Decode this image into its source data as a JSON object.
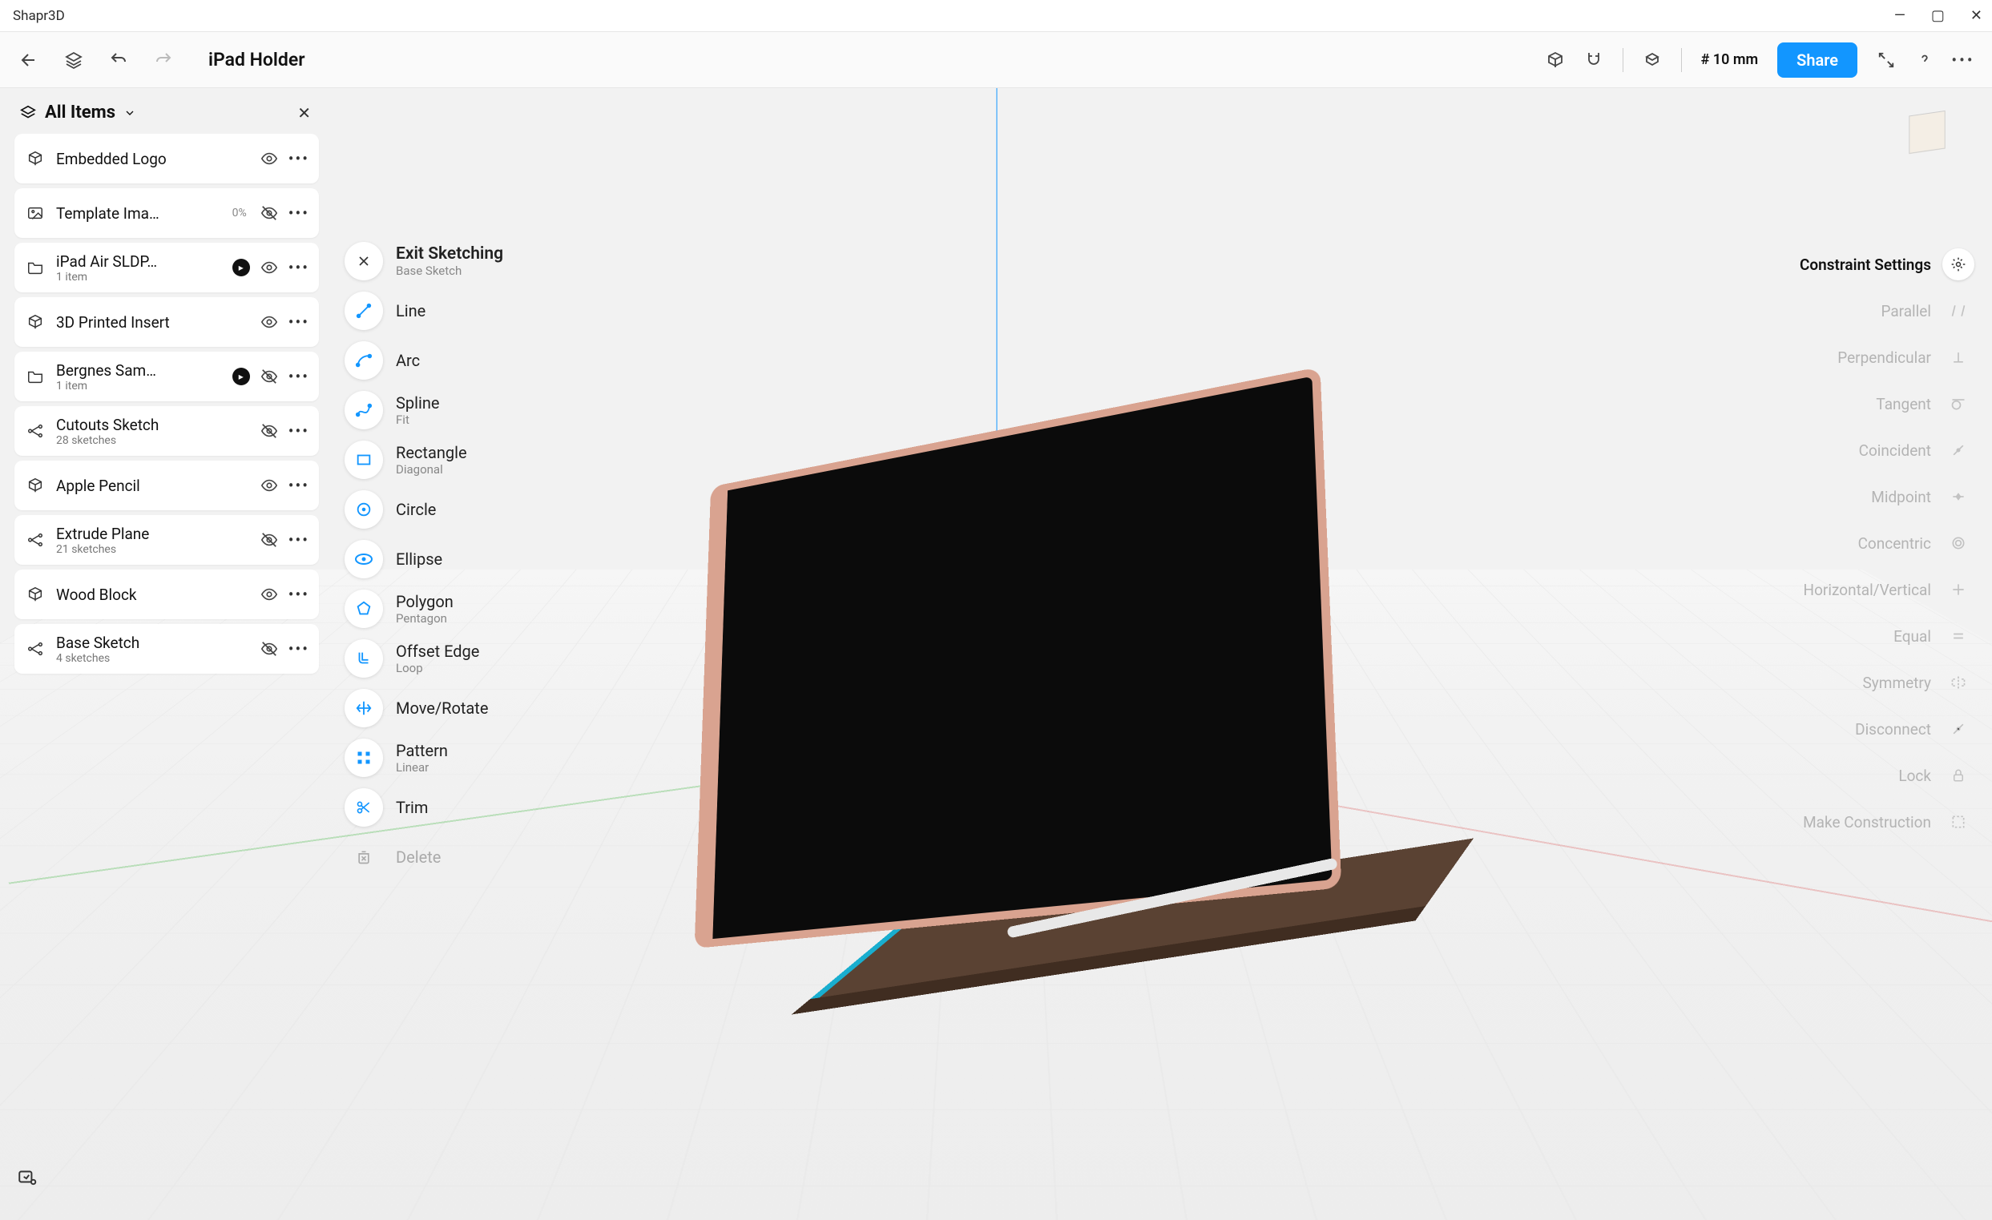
{
  "app_title": "Shapr3D",
  "document_name": "iPad Holder",
  "toolbar": {
    "snap": "# 10 mm",
    "share": "Share"
  },
  "items_panel": {
    "title": "All Items",
    "rows": [
      {
        "icon": "body",
        "label": "Embedded Logo",
        "sub": "",
        "visible": true
      },
      {
        "icon": "image",
        "label": "Template Ima…",
        "sub": "",
        "visible": false,
        "badge": "0%"
      },
      {
        "icon": "folder",
        "label": "iPad Air SLDP…",
        "sub": "1 item",
        "visible": true,
        "caret": true
      },
      {
        "icon": "body",
        "label": "3D Printed Insert",
        "sub": "",
        "visible": true
      },
      {
        "icon": "folder",
        "label": "Bergnes Sam…",
        "sub": "1 item",
        "visible": false,
        "caret": true
      },
      {
        "icon": "sketch",
        "label": "Cutouts Sketch",
        "sub": "28 sketches",
        "visible": false
      },
      {
        "icon": "body",
        "label": "Apple Pencil",
        "sub": "",
        "visible": true
      },
      {
        "icon": "sketch",
        "label": "Extrude Plane",
        "sub": "21 sketches",
        "visible": false
      },
      {
        "icon": "body",
        "label": "Wood Block",
        "sub": "",
        "visible": true
      },
      {
        "icon": "sketch",
        "label": "Base Sketch",
        "sub": "4 sketches",
        "visible": false
      }
    ]
  },
  "tools": [
    {
      "label": "Exit Sketching",
      "sub": "Base Sketch",
      "kind": "exit"
    },
    {
      "label": "Line"
    },
    {
      "label": "Arc"
    },
    {
      "label": "Spline",
      "sub": "Fit"
    },
    {
      "label": "Rectangle",
      "sub": "Diagonal"
    },
    {
      "label": "Circle"
    },
    {
      "label": "Ellipse"
    },
    {
      "label": "Polygon",
      "sub": "Pentagon"
    },
    {
      "label": "Offset Edge",
      "sub": "Loop"
    },
    {
      "label": "Move/Rotate"
    },
    {
      "label": "Pattern",
      "sub": "Linear"
    },
    {
      "label": "Trim"
    },
    {
      "label": "Delete",
      "kind": "ghost"
    }
  ],
  "constraints": {
    "header": "Constraint Settings",
    "rows": [
      "Parallel",
      "Perpendicular",
      "Tangent",
      "Coincident",
      "Midpoint",
      "Concentric",
      "Horizontal/Vertical",
      "Equal",
      "Symmetry",
      "Disconnect",
      "Lock",
      "Make Construction"
    ]
  }
}
